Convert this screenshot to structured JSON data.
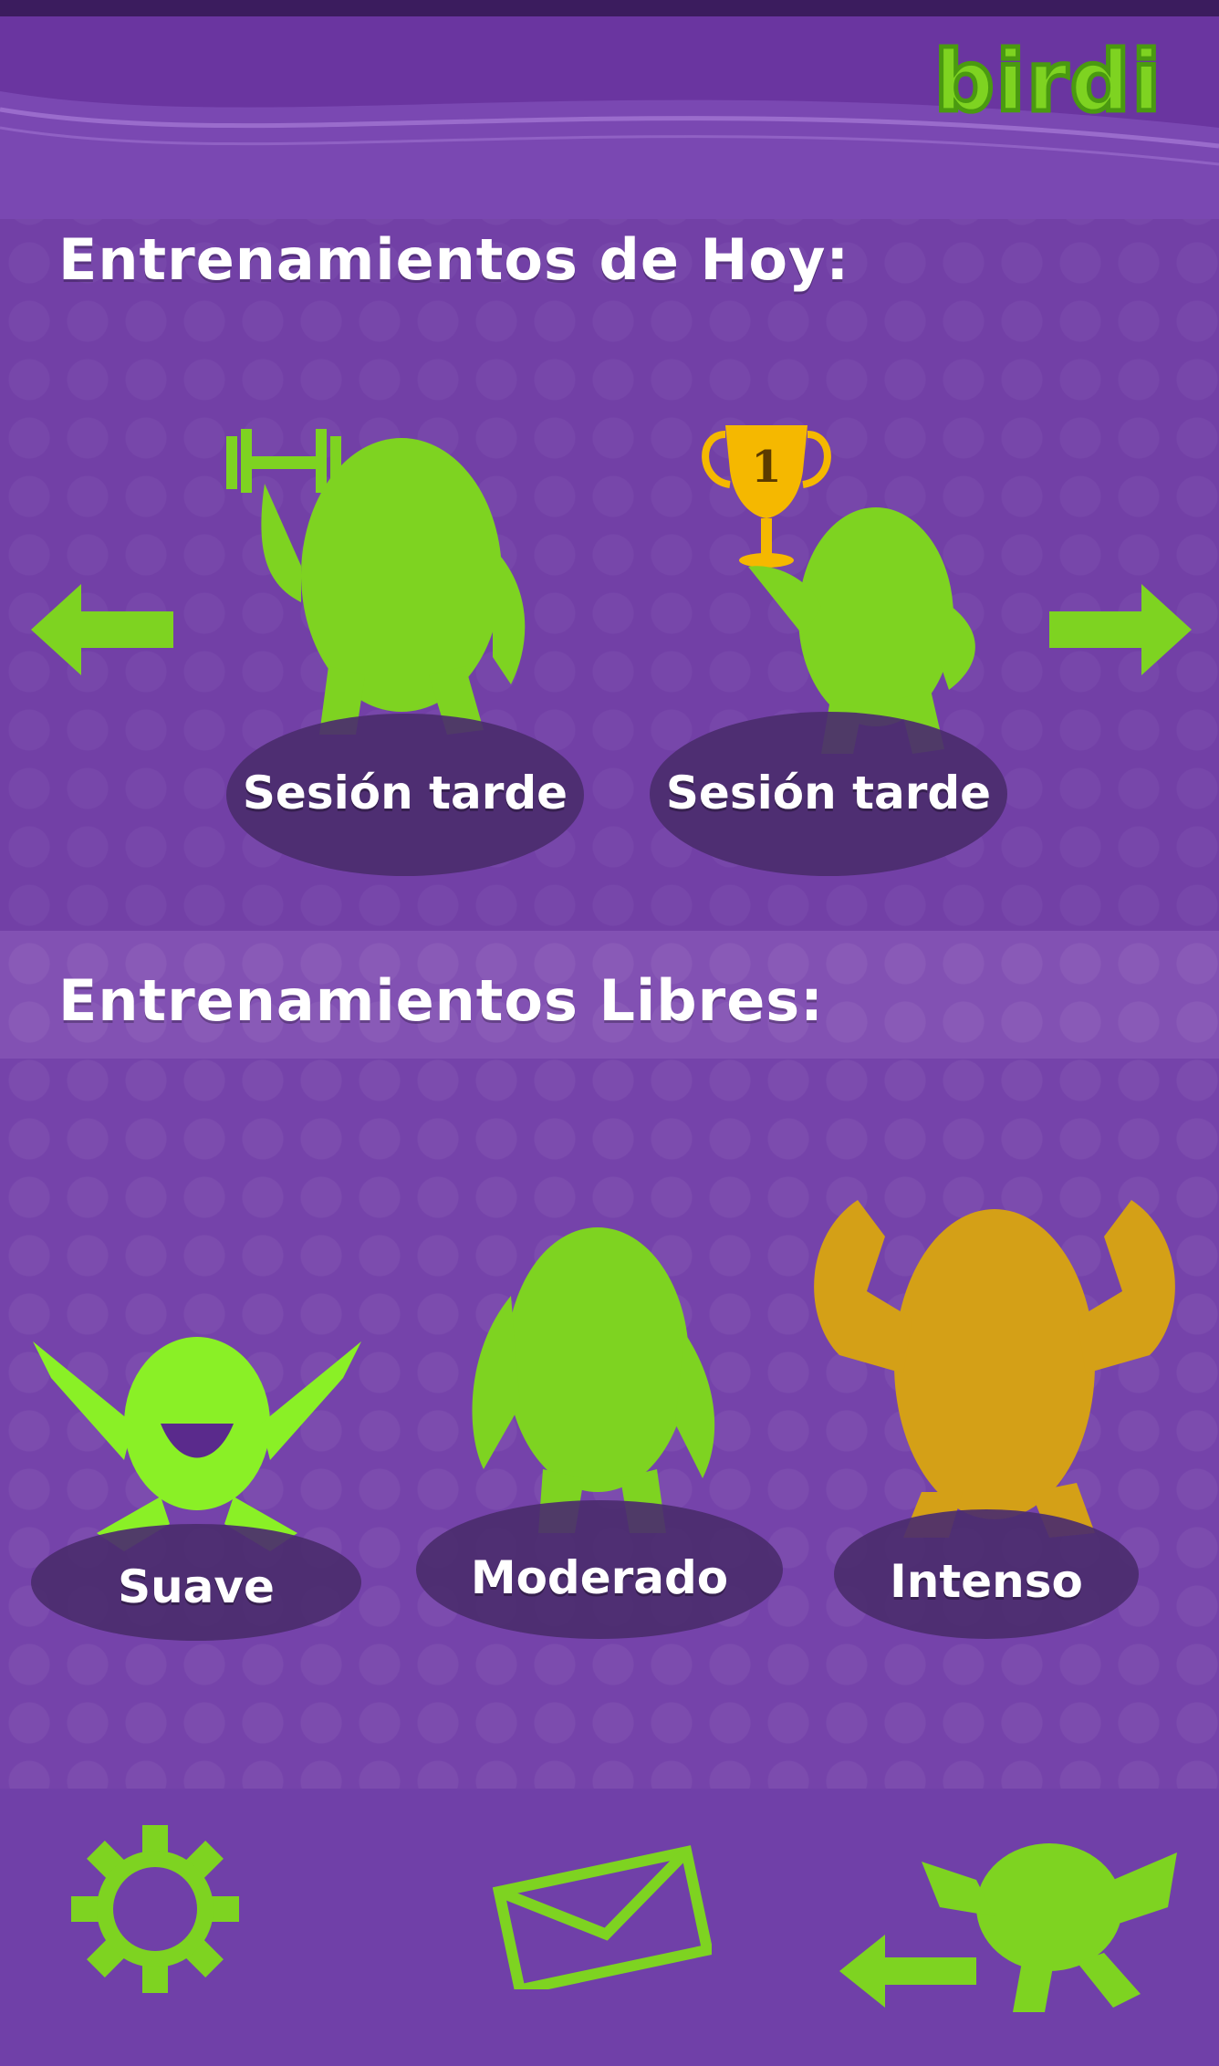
{
  "app": {
    "logo": "birdi"
  },
  "today_section": {
    "title": "Entrenamientos de Hoy:",
    "sessions": [
      {
        "label": "Sesión tarde",
        "icon": "dumbbell-icon"
      },
      {
        "label": "Sesión tarde",
        "icon": "trophy-icon",
        "trophy_number": "1"
      }
    ]
  },
  "free_section": {
    "title": "Entrenamientos Libres:",
    "levels": [
      {
        "label": "Suave"
      },
      {
        "label": "Moderado"
      },
      {
        "label": "Intenso"
      }
    ]
  },
  "colors": {
    "accent_green": "#7ed321",
    "gold": "#d4a017",
    "plate": "#4b2c6e",
    "background": "#6b3aa3"
  },
  "bottom_bar": {
    "settings_icon": "gear-icon",
    "messages_icon": "envelope-icon",
    "back_icon": "back-arrow-icon"
  }
}
